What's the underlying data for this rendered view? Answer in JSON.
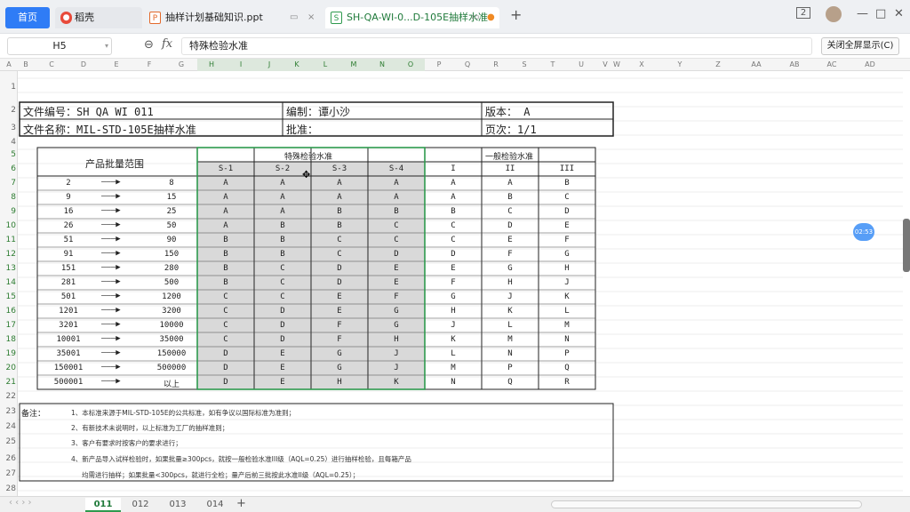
{
  "tabs": [
    {
      "label": "首页"
    },
    {
      "label": "稻壳"
    },
    {
      "label": "抽样计划基础知识.ppt"
    },
    {
      "label": "SH-QA-WI-0...D-105E抽样水准"
    }
  ],
  "toolbar": {
    "exit_fullscreen": "关闭全屏显示(C)",
    "page_count": "2"
  },
  "formula_bar": {
    "cell_ref": "H5",
    "formula": "特殊检验水准"
  },
  "columns": [
    "A",
    "B",
    "C",
    "D",
    "E",
    "F",
    "G",
    "H",
    "I",
    "J",
    "K",
    "L",
    "M",
    "N",
    "O",
    "P",
    "Q",
    "R",
    "S",
    "T",
    "U",
    "V",
    "W",
    "X",
    "Y",
    "Z",
    "AA",
    "AB",
    "AC",
    "AD"
  ],
  "rows": [
    "1",
    "2",
    "3",
    "4",
    "5",
    "6",
    "7",
    "8",
    "9",
    "10",
    "11",
    "12",
    "13",
    "14",
    "15",
    "16",
    "17",
    "18",
    "19",
    "20",
    "21",
    "22",
    "23",
    "24",
    "25",
    "26",
    "27",
    "28"
  ],
  "doc": {
    "file_no": "文件编号：SH QA WI 011",
    "editor": "编制：谭小沙",
    "version": "版本：  A",
    "file_name": "文件名称：MIL-STD-105E抽样水准",
    "approve": "批准：",
    "page": "页次：1/1"
  },
  "table": {
    "lot_header": "产品批量范围",
    "special_header": "特殊检验水准",
    "general_header": "一般检验水准",
    "sub_headers": [
      "S-1",
      "S-2",
      "S-3",
      "S-4",
      "I",
      "II",
      "III"
    ],
    "rows": [
      {
        "from": "2",
        "to": "8",
        "vals": [
          "A",
          "A",
          "A",
          "A",
          "A",
          "A",
          "B"
        ]
      },
      {
        "from": "9",
        "to": "15",
        "vals": [
          "A",
          "A",
          "A",
          "A",
          "A",
          "B",
          "C"
        ]
      },
      {
        "from": "16",
        "to": "25",
        "vals": [
          "A",
          "A",
          "B",
          "B",
          "B",
          "C",
          "D"
        ]
      },
      {
        "from": "26",
        "to": "50",
        "vals": [
          "A",
          "B",
          "B",
          "C",
          "C",
          "D",
          "E"
        ]
      },
      {
        "from": "51",
        "to": "90",
        "vals": [
          "B",
          "B",
          "C",
          "C",
          "C",
          "E",
          "F"
        ]
      },
      {
        "from": "91",
        "to": "150",
        "vals": [
          "B",
          "B",
          "C",
          "D",
          "D",
          "F",
          "G"
        ]
      },
      {
        "from": "151",
        "to": "280",
        "vals": [
          "B",
          "C",
          "D",
          "E",
          "E",
          "G",
          "H"
        ]
      },
      {
        "from": "281",
        "to": "500",
        "vals": [
          "B",
          "C",
          "D",
          "E",
          "F",
          "H",
          "J"
        ]
      },
      {
        "from": "501",
        "to": "1200",
        "vals": [
          "C",
          "C",
          "E",
          "F",
          "G",
          "J",
          "K"
        ]
      },
      {
        "from": "1201",
        "to": "3200",
        "vals": [
          "C",
          "D",
          "E",
          "G",
          "H",
          "K",
          "L"
        ]
      },
      {
        "from": "3201",
        "to": "10000",
        "vals": [
          "C",
          "D",
          "F",
          "G",
          "J",
          "L",
          "M"
        ]
      },
      {
        "from": "10001",
        "to": "35000",
        "vals": [
          "C",
          "D",
          "F",
          "H",
          "K",
          "M",
          "N"
        ]
      },
      {
        "from": "35001",
        "to": "150000",
        "vals": [
          "D",
          "E",
          "G",
          "J",
          "L",
          "N",
          "P"
        ]
      },
      {
        "from": "150001",
        "to": "500000",
        "vals": [
          "D",
          "E",
          "G",
          "J",
          "M",
          "P",
          "Q"
        ]
      },
      {
        "from": "500001",
        "to": "以上",
        "vals": [
          "D",
          "E",
          "H",
          "K",
          "N",
          "Q",
          "R"
        ]
      }
    ]
  },
  "notes": {
    "label": "备注：",
    "lines": [
      "1、本标准来源于MIL-STD-105E的公共标准，如有争议以国际标准为准则；",
      "2、有新技术未说明时，以上标准为工厂的抽样准则；",
      "3、客户有要求时按客户的要求进行；",
      "4、新产品导入试样检验时，如果批量≥300pcs，就按一般检验水准III级（AQL=0.25）进行抽样检验，且每箱产品",
      "均需进行抽样；如果批量<300pcs，就进行全检；量产后前三批按此水准II级（AQL=0.25）；"
    ]
  },
  "sheets": [
    "011",
    "012",
    "013",
    "014"
  ],
  "time_badge": "02:53"
}
